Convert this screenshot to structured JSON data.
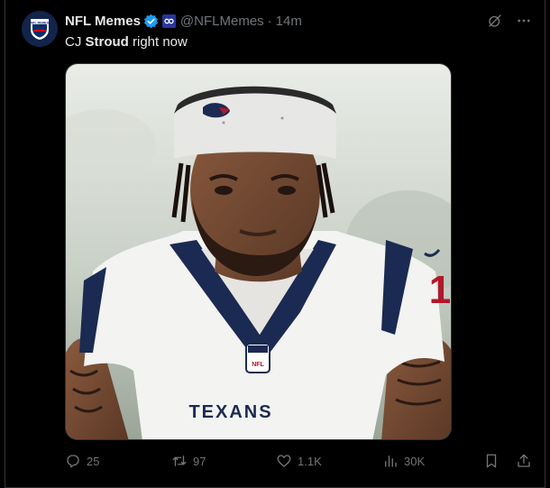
{
  "tweet": {
    "author_name": "NFL Memes",
    "handle": "@NFLMemes",
    "separator": "·",
    "time": "14m",
    "text_prefix": "CJ ",
    "text_bold": "Stroud",
    "text_suffix": " right now",
    "avatar_text": "NFL MEMES",
    "image_jersey_text": "TEXANS",
    "image_jersey_number": "1"
  },
  "actions": {
    "replies": "25",
    "retweets": "97",
    "likes": "1.1K",
    "views": "30K"
  },
  "colors": {
    "background": "#000000",
    "verified": "#1d9bf0",
    "muted": "#71767b",
    "text": "#e7e9ea",
    "jersey_navy": "#1b2a52",
    "jersey_red": "#b0182b"
  },
  "icons": [
    "verified-badge-icon",
    "affiliate-badge-icon",
    "grok-icon",
    "more-icon",
    "reply-icon",
    "retweet-icon",
    "like-icon",
    "views-icon",
    "bookmark-icon",
    "share-icon"
  ]
}
